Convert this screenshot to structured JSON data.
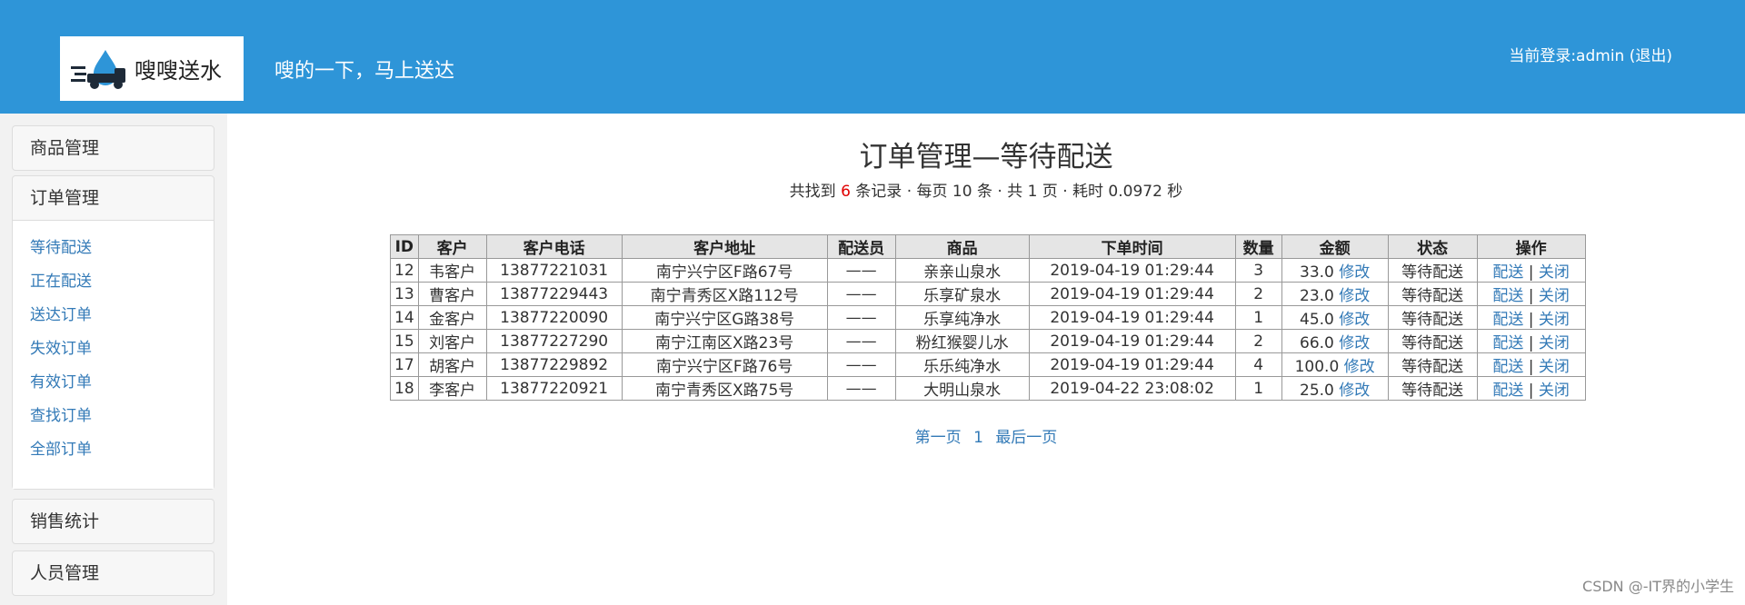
{
  "header": {
    "logo_text": "嗖嗖送水",
    "slogan": "嗖的一下，马上送达",
    "login_prefix": "当前登录:admin ",
    "logout": "(退出)",
    "accent_color": "#2e95d8"
  },
  "sidebar": {
    "goods": "商品管理",
    "orders": "订单管理",
    "order_links": [
      "等待配送",
      "正在配送",
      "送达订单",
      "失效订单",
      "有效订单",
      "查找订单",
      "全部订单"
    ],
    "sales": "销售统计",
    "staff": "人员管理"
  },
  "main": {
    "title": "订单管理—等待配送",
    "summary_pre": "共找到",
    "summary_count": "6",
    "summary_post": "条记录 · 每页 10 条 · 共 1 页 · 耗时 0.0972 秒",
    "columns": [
      "ID",
      "客户",
      "客户电话",
      "客户地址",
      "配送员",
      "商品",
      "下单时间",
      "数量",
      "金额",
      "状态",
      "操作"
    ],
    "rows": [
      {
        "id": "12",
        "customer": "韦客户",
        "phone": "13877221031",
        "address": "南宁兴宁区F路67号",
        "courier": "——",
        "product": "亲亲山泉水",
        "time": "2019-04-19 01:29:44",
        "qty": "3",
        "amount": "33.0",
        "status": "等待配送"
      },
      {
        "id": "13",
        "customer": "曹客户",
        "phone": "13877229443",
        "address": "南宁青秀区X路112号",
        "courier": "——",
        "product": "乐享矿泉水",
        "time": "2019-04-19 01:29:44",
        "qty": "2",
        "amount": "23.0",
        "status": "等待配送"
      },
      {
        "id": "14",
        "customer": "金客户",
        "phone": "13877220090",
        "address": "南宁兴宁区G路38号",
        "courier": "——",
        "product": "乐享纯净水",
        "time": "2019-04-19 01:29:44",
        "qty": "1",
        "amount": "45.0",
        "status": "等待配送"
      },
      {
        "id": "15",
        "customer": "刘客户",
        "phone": "13877227290",
        "address": "南宁江南区X路23号",
        "courier": "——",
        "product": "粉红猴婴儿水",
        "time": "2019-04-19 01:29:44",
        "qty": "2",
        "amount": "66.0",
        "status": "等待配送"
      },
      {
        "id": "17",
        "customer": "胡客户",
        "phone": "13877229892",
        "address": "南宁兴宁区F路76号",
        "courier": "——",
        "product": "乐乐纯净水",
        "time": "2019-04-19 01:29:44",
        "qty": "4",
        "amount": "100.0",
        "status": "等待配送"
      },
      {
        "id": "18",
        "customer": "李客户",
        "phone": "13877220921",
        "address": "南宁青秀区X路75号",
        "courier": "——",
        "product": "大明山泉水",
        "time": "2019-04-22 23:08:02",
        "qty": "1",
        "amount": "25.0",
        "status": "等待配送"
      }
    ],
    "edit_label": "修改",
    "deliver_label": "配送",
    "close_label": "关闭",
    "separator": "|",
    "pager": {
      "first": "第一页",
      "current": "1",
      "last": "最后一页"
    }
  },
  "watermark": "CSDN @-IT界的小学生"
}
